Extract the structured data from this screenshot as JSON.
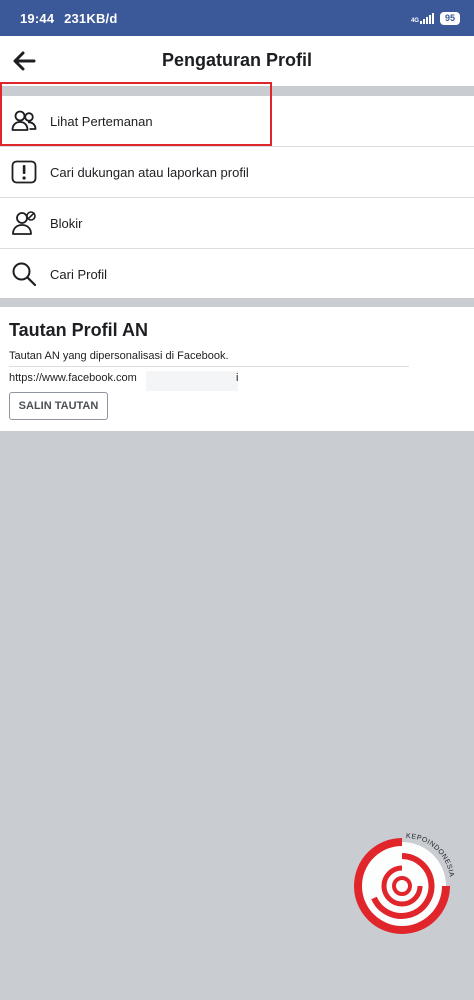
{
  "status_bar": {
    "time": "19:44",
    "speed": "231KB/d",
    "network": "4G",
    "battery": "95"
  },
  "header": {
    "title": "Pengaturan Profil"
  },
  "menu": {
    "items": [
      {
        "label": "Lihat Pertemanan",
        "icon": "friends-icon"
      },
      {
        "label": "Cari dukungan atau laporkan profil",
        "icon": "report-icon"
      },
      {
        "label": "Blokir",
        "icon": "block-user-icon"
      },
      {
        "label": "Cari Profil",
        "icon": "search-icon"
      }
    ],
    "highlight_color": "#e0262a"
  },
  "profile_link": {
    "title": "Tautan Profil AN",
    "description": "Tautan AN yang dipersonalisasi di Facebook.",
    "url_prefix": "https://www.facebook.com",
    "url_suffix": "i",
    "copy_button": "SALIN TAUTAN"
  },
  "watermark": {
    "text": "KEPOINDONESIA"
  },
  "colors": {
    "status_bar": "#3b5998",
    "background_gray": "#c9ccd1",
    "watermark_red": "#e0262a"
  }
}
